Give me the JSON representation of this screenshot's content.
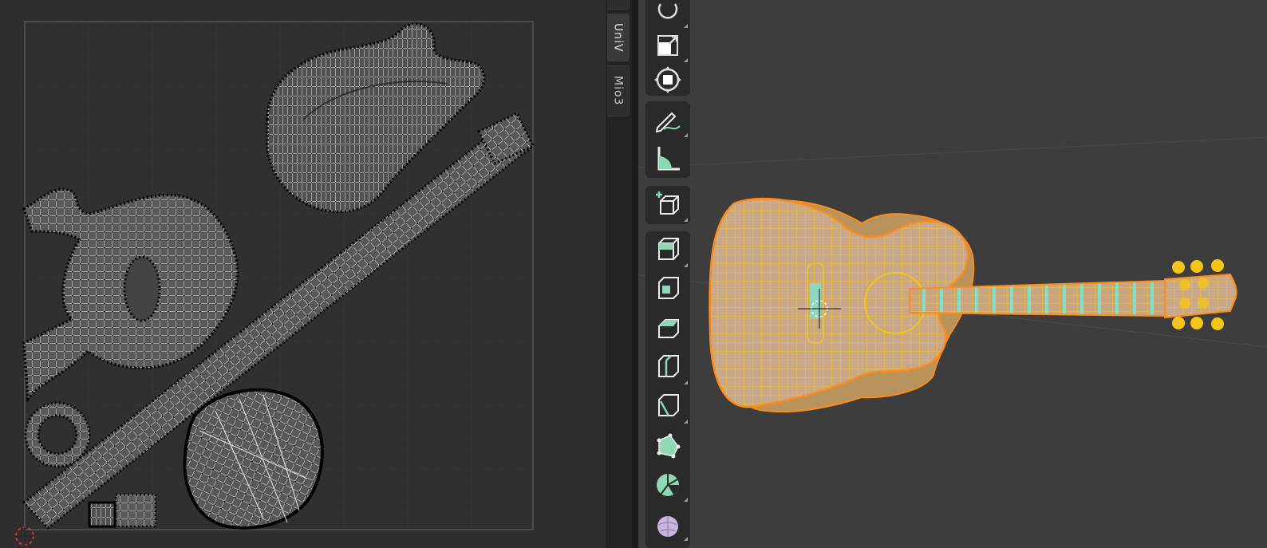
{
  "sidebar_tabs": [
    {
      "label": "",
      "active": false
    },
    {
      "label": "UniV",
      "active": true
    },
    {
      "label": "Mio3",
      "active": false
    }
  ],
  "toolbar": {
    "tools": [
      {
        "icon": "rotate-icon"
      },
      {
        "icon": "scale-icon"
      },
      {
        "icon": "transform-icon"
      },
      {
        "icon": "annotate-icon"
      },
      {
        "icon": "measure-icon"
      },
      {
        "icon": "add-cube-icon"
      },
      {
        "icon": "extrude-region-icon"
      },
      {
        "icon": "inset-faces-icon"
      },
      {
        "icon": "bevel-icon"
      },
      {
        "icon": "loop-cut-icon"
      },
      {
        "icon": "knife-icon"
      },
      {
        "icon": "poly-build-icon"
      },
      {
        "icon": "spin-icon"
      },
      {
        "icon": "smooth-icon"
      }
    ]
  },
  "colors": {
    "selection_orange": "#ff8c1a",
    "wire_yellow": "#f5c518",
    "selected_faces_teal": "#7fe0c8",
    "uv_vertex": "#000000",
    "uv_edge": "#f2f2f2",
    "tool_icon_green": "#8ed8b4",
    "tool_icon_purple": "#c9b6e0"
  }
}
